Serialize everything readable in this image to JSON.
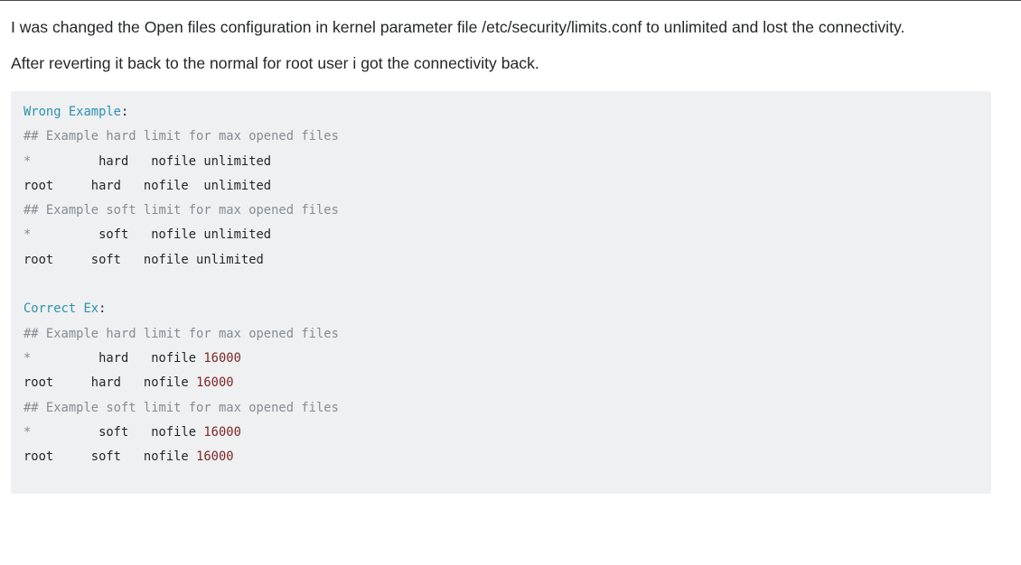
{
  "post": {
    "paragraphs": [
      "I was changed the Open files configuration in kernel parameter file /etc/security/limits.conf to unlimited and lost the connectivity.",
      "After reverting it back to the normal for root user i got the connectivity back."
    ],
    "code_lines": [
      [
        {
          "text": "Wrong Example",
          "kind": "head"
        },
        {
          "text": ":",
          "kind": "plain"
        }
      ],
      [
        {
          "text": "## Example hard limit for max opened files",
          "kind": "comment"
        }
      ],
      [
        {
          "text": "*",
          "kind": "comment"
        },
        {
          "text": "         hard   nofile unlimited",
          "kind": "plain"
        }
      ],
      [
        {
          "text": "root     hard   nofile  unlimited",
          "kind": "plain"
        }
      ],
      [
        {
          "text": "## Example soft limit for max opened files",
          "kind": "comment"
        }
      ],
      [
        {
          "text": "*",
          "kind": "comment"
        },
        {
          "text": "         soft   nofile unlimited",
          "kind": "plain"
        }
      ],
      [
        {
          "text": "root     soft   nofile unlimited",
          "kind": "plain"
        }
      ],
      [
        {
          "text": "",
          "kind": "plain"
        }
      ],
      [
        {
          "text": "Correct Ex",
          "kind": "head"
        },
        {
          "text": ":",
          "kind": "plain"
        }
      ],
      [
        {
          "text": "## Example hard limit for max opened files",
          "kind": "comment"
        }
      ],
      [
        {
          "text": "*",
          "kind": "comment"
        },
        {
          "text": "         hard   nofile ",
          "kind": "plain"
        },
        {
          "text": "16000",
          "kind": "number"
        }
      ],
      [
        {
          "text": "root     hard   nofile ",
          "kind": "plain"
        },
        {
          "text": "16000",
          "kind": "number"
        }
      ],
      [
        {
          "text": "## Example soft limit for max opened files",
          "kind": "comment"
        }
      ],
      [
        {
          "text": "*",
          "kind": "comment"
        },
        {
          "text": "         soft   nofile ",
          "kind": "plain"
        },
        {
          "text": "16000",
          "kind": "number"
        }
      ],
      [
        {
          "text": "root     soft   nofile ",
          "kind": "plain"
        },
        {
          "text": "16000",
          "kind": "number"
        }
      ]
    ]
  },
  "colors": {
    "code_background": "#eff0f1",
    "heading_token": "#2b91af",
    "comment_token": "#858c93",
    "number_token": "#7d2727",
    "body_text": "#242729"
  }
}
